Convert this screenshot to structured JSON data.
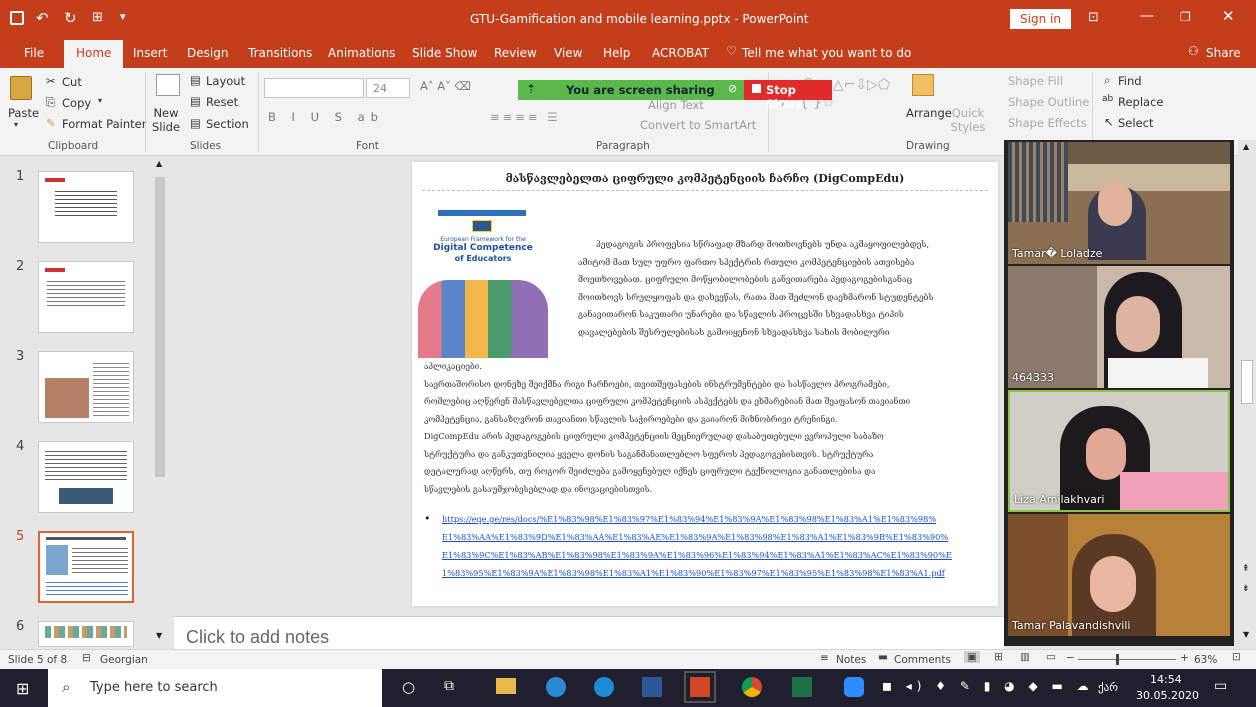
{
  "window": {
    "title": "GTU-Gamification and mobile learning.pptx - PowerPoint",
    "signin": "Sign in"
  },
  "tabs": [
    "File",
    "Home",
    "Insert",
    "Design",
    "Transitions",
    "Animations",
    "Slide Show",
    "Review",
    "View",
    "Help",
    "ACROBAT"
  ],
  "tellme": "Tell me what you want to do",
  "share": "Share",
  "ribbon": {
    "paste": "Paste",
    "cut": "Cut",
    "copy": "Copy",
    "format_painter": "Format Painter",
    "clipboard": "Clipboard",
    "new_slide": "New Slide",
    "layout": "Layout",
    "reset": "Reset",
    "section": "Section",
    "slides": "Slides",
    "font_size": "24",
    "font": "Font",
    "paragraph": "Paragraph",
    "align_text": "Align Text",
    "convert": "Convert to SmartArt",
    "arrange": "Arrange",
    "quick_styles": "Quick Styles",
    "shape_fill": "Shape Fill",
    "shape_outline": "Shape Outline",
    "shape_effects": "Shape Effects",
    "drawing": "Drawing",
    "find": "Find",
    "replace": "Replace",
    "select": "Select"
  },
  "sharing": {
    "label": "You are screen sharing",
    "stop": "Stop Share"
  },
  "slide": {
    "title": "მასწავლებელთა ციფრული კომპეტენციის ჩარჩო (DigCompEdu)",
    "cover": {
      "l1": "European Framework for the",
      "l2": "Digital Competence",
      "l3": "of Educators"
    },
    "lines": [
      "პედაგოგის პროფესია სწრაფად მზარდ მოთხოვნებს უნდა აკმაყოფილებდეს,",
      "ამიტომ მათ სულ უფრო ფართო სპექტრის რთული კომპეტენციების ათვისება",
      "მოეთხოვებათ. ციფრული მოწყობილობების განვითარება პედაგოგებისგანაც",
      "მოითხოვს სრულყოფას და დახვეწას, რათა მათ შეძლონ დაეხმარონ სტუდენტებს",
      "განავითარონ საკუთარი უნარები და სწავლის პროცესში სხვადასხვა ტიპის",
      "დავალებების შესრულებისას გამოიყენონ სხვადასხვა სახის მობილური"
    ],
    "lines2": [
      "აპლიკაციები.",
      "საერთაშორისო დონეზე შეიქმნა რიგი ჩარჩოები, თვითშეფასების ინსტრუმენტები და სასწავლო პროგრამები,",
      "რომლებიც აღწერენ მასწავლებელთა ციფრული კომპეტენციის ასპექტებს და ეხმარებიან მათ შეაფასონ თავიანთი",
      "კომპეტენცია, განსაზღვრონ თავიანთი სწავლის საჭიროებები და გაიარონ მიზნობრივი ტრენინგი.",
      "DigCompEdu არის პედაგოგების ციფრული კომპეტენციის მეცნიერულად დასაბუთებული ევროპული საბაზო",
      "სტრუქტურა და განკუთვნილია ყველა დონის საგანმანათლებლო სფეროს პედაგოგებისთვის. სტრუქტურა",
      "დეტალურად აღწერს, თუ როგორ შეიძლება გამოყენებულ იქნეს ციფრული ტექნოლოგია განათლებისა და",
      "სწავლების გასაუმჯობესებლად და ინოვაციებისთვის."
    ],
    "bullet": "•",
    "link": [
      "https://eqe.ge/res/docs/%E1%83%98%E1%83%97%E1%83%94%E1%83%9A%E1%83%98%E1%83%A1%E1%83%98%",
      "E1%83%AA%E1%83%9D%E1%83%AA%E1%83%AE%E1%83%9A%E1%83%98%E1%83%A1%E1%83%9B%E1%83%90%",
      "E1%83%9C%E1%83%AB%E1%83%98%E1%83%9A%E1%83%96%E1%83%94%E1%83%A1%E1%83%AC%E1%83%90%E",
      "1%83%95%E1%83%9A%E1%83%98%E1%83%A1%E1%83%90%E1%83%97%E1%83%95%E1%83%98%E1%83%A1.pdf"
    ]
  },
  "thumbs": [
    "1",
    "2",
    "3",
    "4",
    "5",
    "6"
  ],
  "notes": "Click to add notes",
  "participants": [
    "Tamar� Loladze",
    "464333",
    "Liza Amilakhvari",
    "Tamar Palavandishvili"
  ],
  "status": {
    "slide": "Slide 5 of 8",
    "lang": "Georgian",
    "notes": "Notes",
    "comments": "Comments",
    "zoom": "63%"
  },
  "taskbar": {
    "search": "Type here to search",
    "lang": "ქარ",
    "time": "14:54",
    "date": "30.05.2020"
  },
  "colors": {
    "accent": "#c43e1c",
    "green": "#5bb84a"
  }
}
